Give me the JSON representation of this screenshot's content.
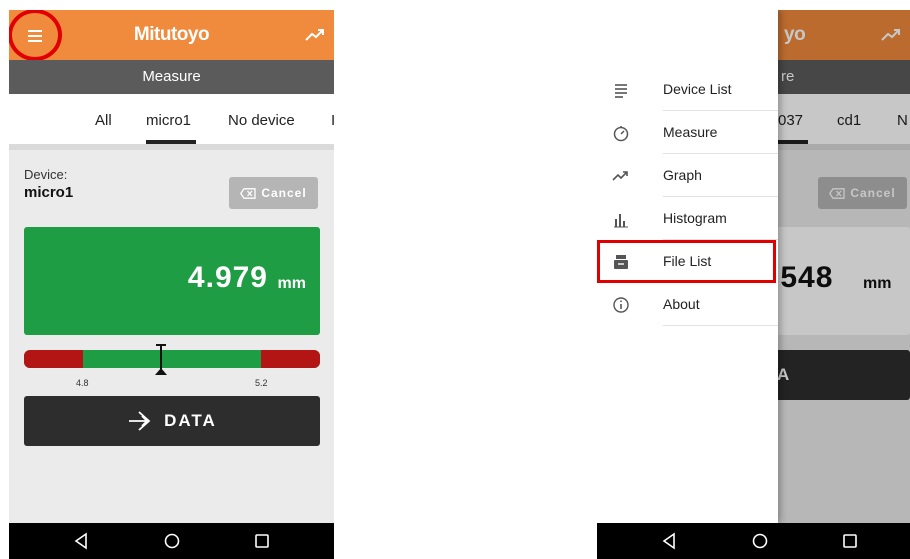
{
  "left_screen": {
    "app_logo": "Mitutoyo",
    "subtitle": "Measure",
    "tabs": [
      {
        "label": "All"
      },
      {
        "label": "micro1"
      },
      {
        "label": "No device"
      },
      {
        "label": "I"
      }
    ],
    "device_label": "Device:",
    "device_name": "micro1",
    "cancel_label": "Cancel",
    "value": "4.979",
    "unit": "mm",
    "tolerance": {
      "lower": "4.8",
      "upper": "5.2",
      "reading_fraction": 0.46
    },
    "data_button_label": "DATA",
    "value_card_color": "#1e9d45"
  },
  "right_screen": {
    "app_logo_partial": "yo",
    "subtitle_partial": "re",
    "tabs_partial": [
      {
        "label": "037"
      },
      {
        "label": "cd1"
      },
      {
        "label": "N"
      }
    ],
    "cancel_label": "Cancel",
    "value_partial": ".548",
    "unit": "mm",
    "data_button_partial": "A",
    "drawer_items": [
      {
        "label": "Device List",
        "icon": "list-icon"
      },
      {
        "label": "Measure",
        "icon": "gauge-icon"
      },
      {
        "label": "Graph",
        "icon": "trend-icon"
      },
      {
        "label": "Histogram",
        "icon": "histogram-icon"
      },
      {
        "label": "File List",
        "icon": "inbox-icon"
      },
      {
        "label": "About",
        "icon": "info-icon"
      }
    ],
    "highlighted_item": "File List",
    "highlight_color": "#e00000"
  },
  "colors": {
    "app_bar": "#f08a3c",
    "sub_bar": "#5b5b5b",
    "in_tolerance": "#1e9d45",
    "out_tolerance": "#b31515",
    "data_button": "#2d2d2d"
  }
}
